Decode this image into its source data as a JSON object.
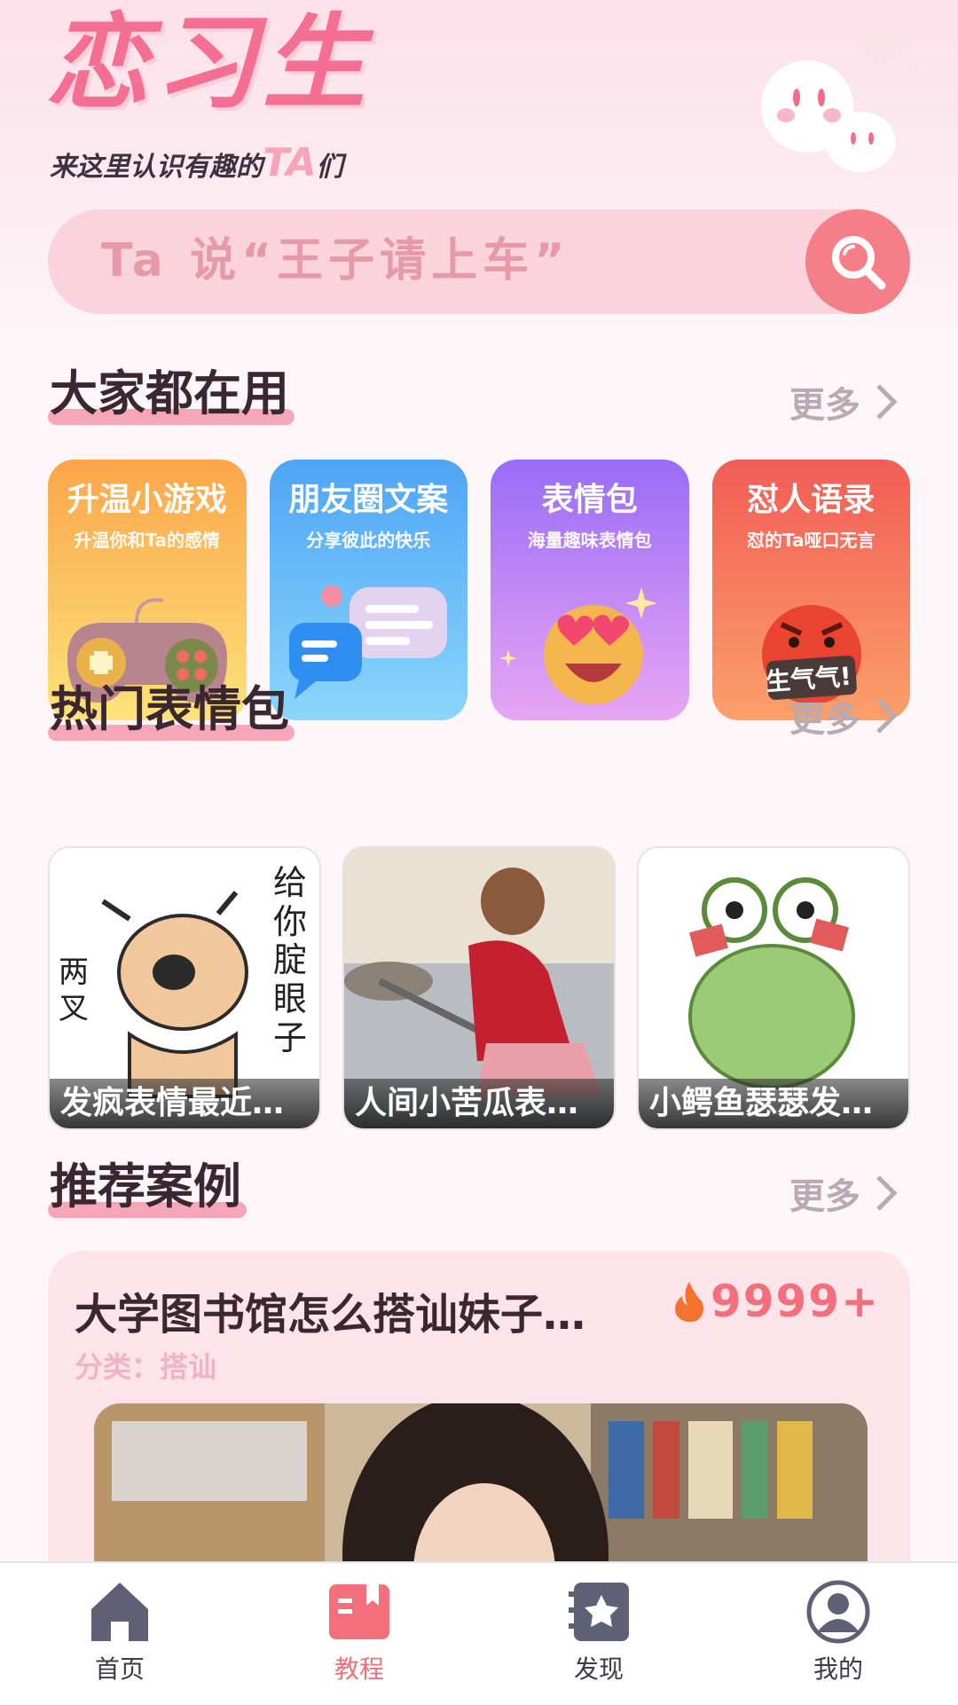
{
  "header": {
    "logo": "恋习生",
    "slogan_prefix": "来这里认识有趣的",
    "slogan_ta": "TA",
    "slogan_suffix": "们"
  },
  "search": {
    "text": "Ta 说“王子请上车”"
  },
  "section_popular": {
    "title": "大家都在用",
    "more": "更多"
  },
  "popular_cards": [
    {
      "title": "升温小游戏",
      "subtitle": "升温你和Ta的感情"
    },
    {
      "title": "朋友圈文案",
      "subtitle": "分享彼此的快乐"
    },
    {
      "title": "表情包",
      "subtitle": "海量趣味表情包"
    },
    {
      "title": "怼人语录",
      "subtitle": "怼的Ta哑口无言",
      "badge": "生气气!"
    }
  ],
  "section_stickers": {
    "title": "热门表情包",
    "more": "更多"
  },
  "stickers": [
    {
      "caption": "发疯表情最近…",
      "art_text_1": "两叉",
      "art_text_2": "给你腚眼子"
    },
    {
      "caption": "人间小苦瓜表…"
    },
    {
      "caption": "小鳄鱼瑟瑟发…"
    }
  ],
  "section_cases": {
    "title": "推荐案例",
    "more": "更多"
  },
  "case": {
    "title": "大学图书馆怎么搭讪妹子…",
    "hot": "9999+",
    "category": "分类：搭讪"
  },
  "tabbar": {
    "items": [
      {
        "label": "首页"
      },
      {
        "label": "教程"
      },
      {
        "label": "发现"
      },
      {
        "label": "我的"
      }
    ],
    "active_index": 1
  },
  "colors": {
    "accent": "#f46f7c",
    "pink": "#f7a6b8",
    "text": "#3a2730"
  }
}
